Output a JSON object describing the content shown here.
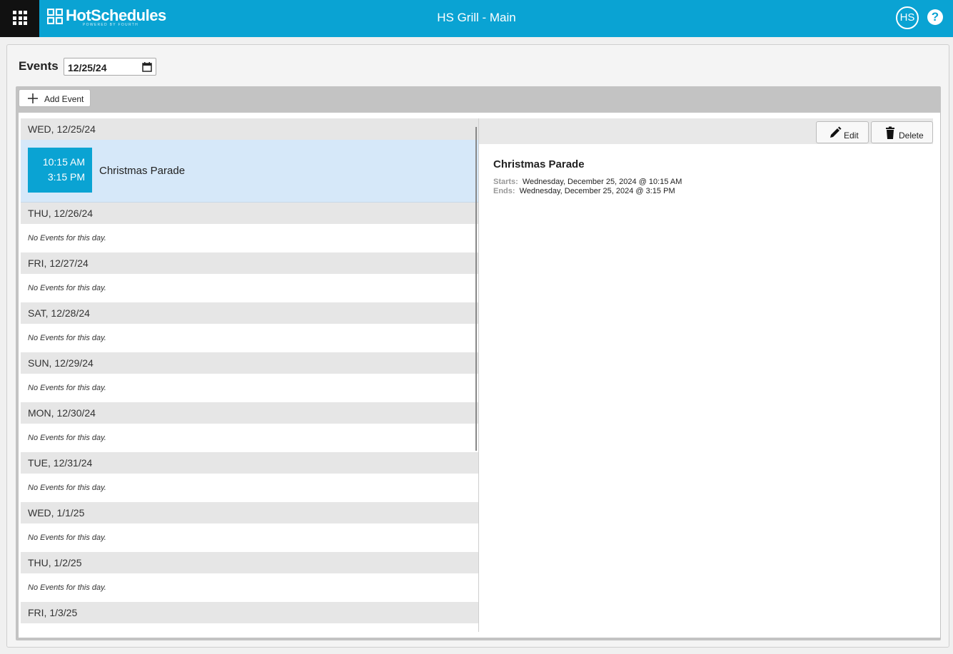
{
  "topbar": {
    "logo_text": "HotSchedules",
    "logo_sub": "POWERED BY FOURTH",
    "title": "HS Grill - Main",
    "avatar_initials": "HS",
    "help_label": "?",
    "accent_color": "#0aa3d3"
  },
  "events": {
    "label": "Events",
    "date_value": "12/25/24",
    "add_label": "Add Event"
  },
  "list": {
    "no_events_text": "No Events for this day.",
    "days": [
      {
        "label": "WED, 12/25/24"
      },
      {
        "label": "THU, 12/26/24"
      },
      {
        "label": "FRI, 12/27/24"
      },
      {
        "label": "SAT, 12/28/24"
      },
      {
        "label": "SUN, 12/29/24"
      },
      {
        "label": "MON, 12/30/24"
      },
      {
        "label": "TUE, 12/31/24"
      },
      {
        "label": "WED, 1/1/25"
      },
      {
        "label": "THU, 1/2/25"
      },
      {
        "label": "FRI, 1/3/25"
      }
    ],
    "event": {
      "start": "10:15 AM",
      "end": "3:15 PM",
      "name": "Christmas Parade"
    }
  },
  "detail": {
    "edit_label": "Edit",
    "delete_label": "Delete",
    "title": "Christmas Parade",
    "starts_key": "Starts:",
    "starts_value": "Wednesday, December 25, 2024 @ 10:15 AM",
    "ends_key": "Ends:",
    "ends_value": "Wednesday, December 25, 2024 @ 3:15 PM"
  },
  "icons": {
    "apps": "grid-icon",
    "date": "calendar-icon",
    "add": "plus-icon",
    "edit": "pencil-icon",
    "delete": "trash-icon"
  }
}
